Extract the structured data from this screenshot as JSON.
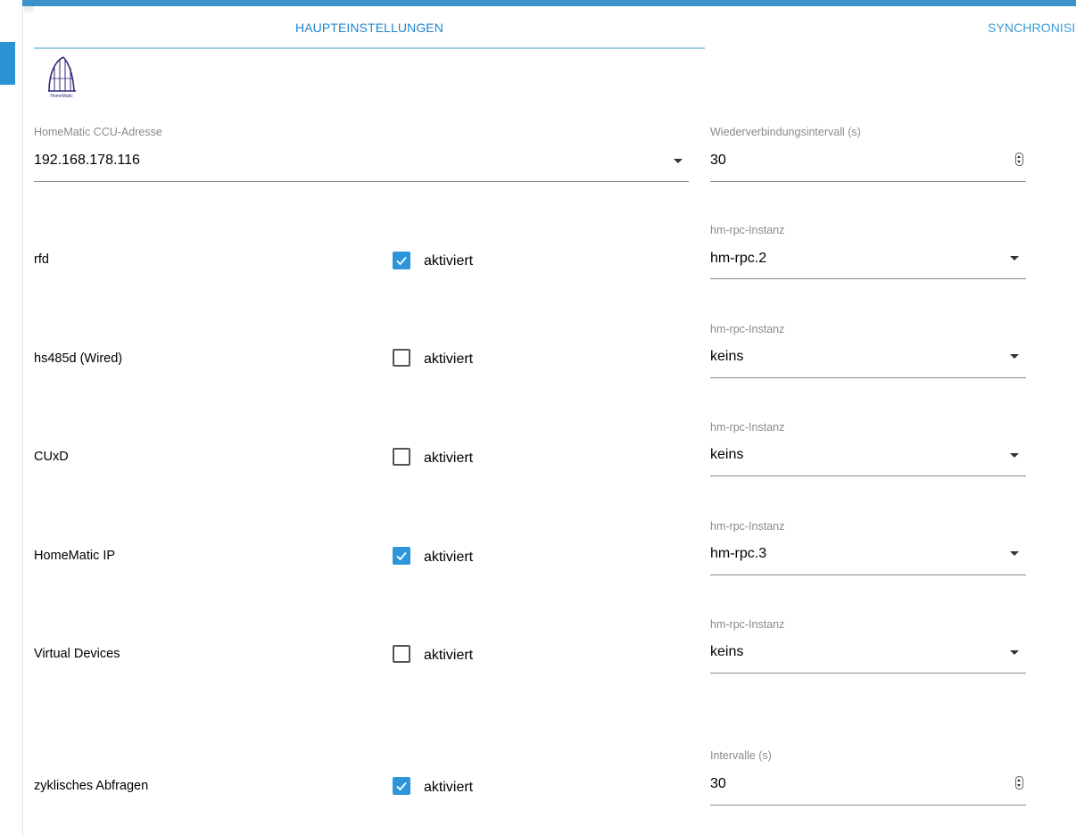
{
  "tabs": [
    {
      "label": "HAUPTEINSTELLUNGEN",
      "active": true
    },
    {
      "label": "SYNCHRONISIE",
      "active": false
    }
  ],
  "logo": {
    "text": "HomeMatic",
    "icon": "homematic-logo"
  },
  "ccu": {
    "label": "HomeMatic CCU-Adresse",
    "value": "192.168.178.116"
  },
  "reconnect": {
    "label": "Wiederverbindungsintervall (s)",
    "value": "30"
  },
  "rows": [
    {
      "name": "rfd",
      "checked": true,
      "checkbox_label": "aktiviert",
      "instance_label": "hm-rpc-Instanz",
      "instance": "hm-rpc.2"
    },
    {
      "name": "hs485d (Wired)",
      "checked": false,
      "checkbox_label": "aktiviert",
      "instance_label": "hm-rpc-Instanz",
      "instance": "keins"
    },
    {
      "name": "CUxD",
      "checked": false,
      "checkbox_label": "aktiviert",
      "instance_label": "hm-rpc-Instanz",
      "instance": "keins"
    },
    {
      "name": "HomeMatic IP",
      "checked": true,
      "checkbox_label": "aktiviert",
      "instance_label": "hm-rpc-Instanz",
      "instance": "hm-rpc.3"
    },
    {
      "name": "Virtual Devices",
      "checked": false,
      "checkbox_label": "aktiviert",
      "instance_label": "hm-rpc-Instanz",
      "instance": "keins"
    }
  ],
  "polling": {
    "name": "zyklisches Abfragen",
    "checked": true,
    "checkbox_label": "aktiviert",
    "interval_label": "Intervalle (s)",
    "interval": "30"
  },
  "colors": {
    "accent": "#2d95d9",
    "top_bar": "#3b93c9",
    "tab_indicator": "#9ad2e3"
  }
}
